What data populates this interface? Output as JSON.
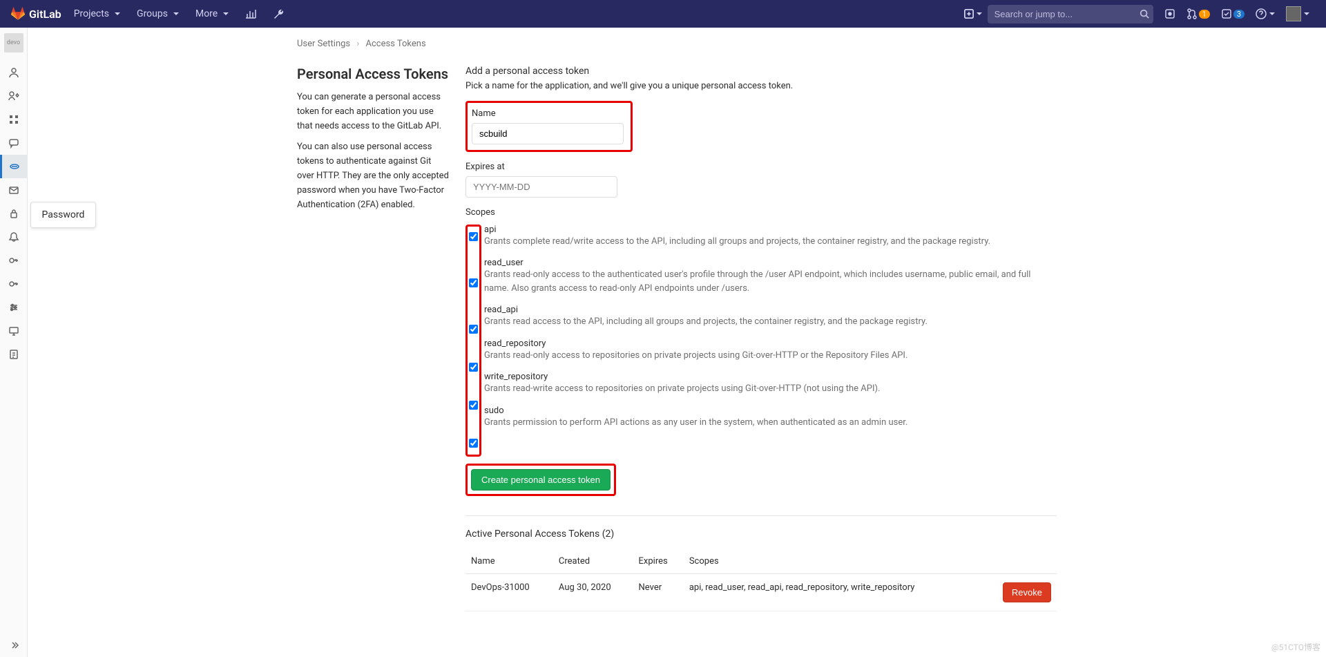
{
  "topbar": {
    "brand": "GitLab",
    "nav": {
      "projects": "Projects",
      "groups": "Groups",
      "more": "More"
    },
    "search_placeholder": "Search or jump to...",
    "mr_badge": "1",
    "todo_badge": "3"
  },
  "sidebar": {
    "avatar_alt": "devo",
    "tooltip": "Password"
  },
  "breadcrumb": {
    "user_settings": "User Settings",
    "current": "Access Tokens"
  },
  "left": {
    "title": "Personal Access Tokens",
    "p1": "You can generate a personal access token for each application you use that needs access to the GitLab API.",
    "p2": "You can also use personal access tokens to authenticate against Git over HTTP. They are the only accepted password when you have Two-Factor Authentication (2FA) enabled."
  },
  "form": {
    "title": "Add a personal access token",
    "subtitle": "Pick a name for the application, and we'll give you a unique personal access token.",
    "name_label": "Name",
    "name_value": "scbuild",
    "expires_label": "Expires at",
    "expires_placeholder": "YYYY-MM-DD",
    "scopes_label": "Scopes",
    "scopes": [
      {
        "key": "api",
        "label": "api",
        "desc": "Grants complete read/write access to the API, including all groups and projects, the container registry, and the package registry.",
        "checked": true
      },
      {
        "key": "read_user",
        "label": "read_user",
        "desc": "Grants read-only access to the authenticated user's profile through the /user API endpoint, which includes username, public email, and full name. Also grants access to read-only API endpoints under /users.",
        "checked": true
      },
      {
        "key": "read_api",
        "label": "read_api",
        "desc": "Grants read access to the API, including all groups and projects, the container registry, and the package registry.",
        "checked": true
      },
      {
        "key": "read_repository",
        "label": "read_repository",
        "desc": "Grants read-only access to repositories on private projects using Git-over-HTTP or the Repository Files API.",
        "checked": true
      },
      {
        "key": "write_repository",
        "label": "write_repository",
        "desc": "Grants read-write access to repositories on private projects using Git-over-HTTP (not using the API).",
        "checked": true
      },
      {
        "key": "sudo",
        "label": "sudo",
        "desc": "Grants permission to perform API actions as any user in the system, when authenticated as an admin user.",
        "checked": true
      }
    ],
    "submit": "Create personal access token"
  },
  "active": {
    "title": "Active Personal Access Tokens (2)",
    "headers": {
      "name": "Name",
      "created": "Created",
      "expires": "Expires",
      "scopes": "Scopes"
    },
    "rows": [
      {
        "name": "DevOps-31000",
        "created": "Aug 30, 2020",
        "expires": "Never",
        "scopes": "api, read_user, read_api, read_repository, write_repository",
        "action": "Revoke"
      }
    ]
  },
  "watermark": "@51CTO博客"
}
